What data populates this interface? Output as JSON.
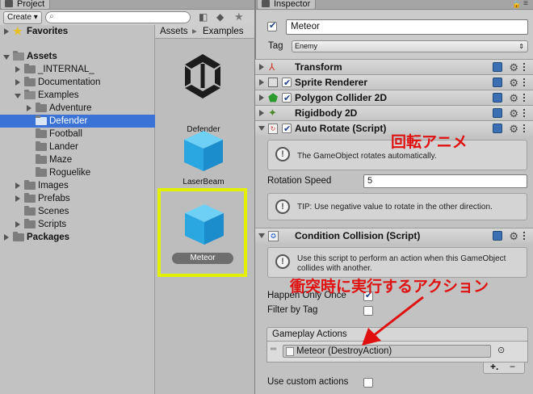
{
  "project": {
    "tab_label": "Project",
    "create_label": "Create ▾",
    "search_placeholder": "",
    "tree": {
      "favorites": "Favorites",
      "assets": "Assets",
      "internal": "_INTERNAL_",
      "documentation": "Documentation",
      "examples": "Examples",
      "adventure": "Adventure",
      "defender": "Defender",
      "football": "Football",
      "lander": "Lander",
      "maze": "Maze",
      "roguelike": "Roguelike",
      "images": "Images",
      "prefabs": "Prefabs",
      "scenes": "Scenes",
      "scripts": "Scripts",
      "packages": "Packages"
    },
    "breadcrumb": {
      "root": "Assets",
      "sep": "▸",
      "child": "Examples"
    },
    "assets": [
      {
        "label": "Defender"
      },
      {
        "label": "LaserBeam"
      },
      {
        "label": "Meteor"
      }
    ]
  },
  "inspector": {
    "tab_label": "Inspector",
    "object_name": "Meteor",
    "tag_label": "Tag",
    "tag_value": "Enemy",
    "components": {
      "transform": "Transform",
      "sprite_renderer": "Sprite Renderer",
      "polygon_collider": "Polygon Collider 2D",
      "rigidbody": "Rigidbody 2D",
      "auto_rotate": "Auto Rotate (Script)",
      "condition_collision": "Condition Collision (Script)"
    },
    "auto_rotate": {
      "info": "The GameObject rotates automatically.",
      "speed_label": "Rotation Speed",
      "speed_value": "5",
      "tip": "TIP: Use negative value to rotate in the other direction."
    },
    "condition_collision": {
      "info_line1": "Use this script to perform an action when this GameObject",
      "info_line2": "collides with another.",
      "happen_once_label": "Happen Only Once",
      "happen_once": true,
      "filter_label": "Filter by Tag",
      "filter": false,
      "actions_header": "Gameplay Actions",
      "action_item": "Meteor (DestroyAction)",
      "add_label": "+.",
      "remove_label": "−",
      "custom_label": "Use custom actions",
      "custom": false
    }
  },
  "annotations": {
    "rotate_anime": "回転アニメ",
    "collision_action": "衝突時に実行するアクション",
    "highlight_color": "#e2f000",
    "arrow_color": "#e01010"
  }
}
